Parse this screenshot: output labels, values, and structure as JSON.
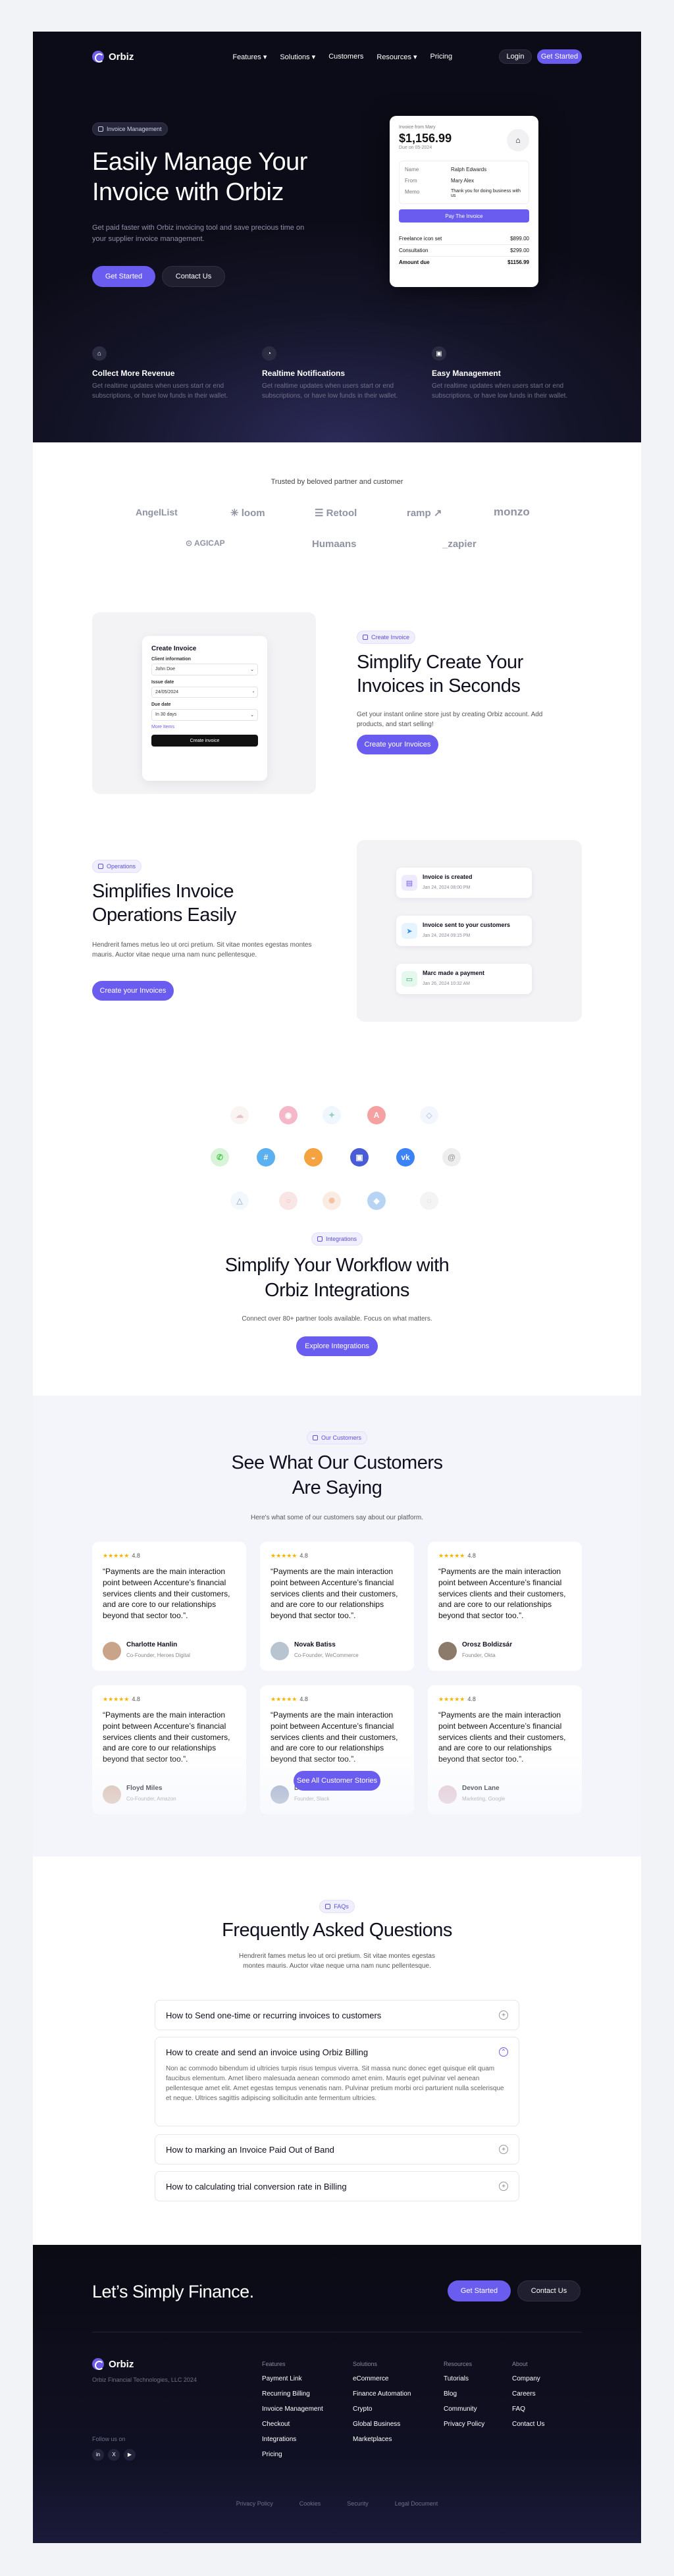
{
  "nav": {
    "brand": "Orbiz",
    "links": [
      "Features",
      "Solutions",
      "Customers",
      "Resources",
      "Pricing"
    ],
    "login": "Login",
    "get_started": "Get Started"
  },
  "hero": {
    "badge": "Invoice Management",
    "title_line1": "Easily Manage Your",
    "title_line2": "Invoice with Orbiz",
    "subtitle": "Get paid faster with Orbiz invoicing tool and save precious time on your supplier invoice management.",
    "cta_primary": "Get Started",
    "cta_secondary": "Contact Us",
    "invoice": {
      "label": "Invoice from Mary",
      "amount": "$1,156.99",
      "due": "Due on 05-2024",
      "rows": [
        {
          "k": "Name",
          "v": "Ralph Edwards"
        },
        {
          "k": "From",
          "v": "Mary Alex"
        },
        {
          "k": "Memo",
          "v": "Thank you for doing business with us"
        }
      ],
      "pay": "Pay The Invoice",
      "lines": [
        {
          "k": "Freelance icon set",
          "v": "$899.00"
        },
        {
          "k": "Consultation",
          "v": "$299.00"
        },
        {
          "k": "Amount due",
          "v": "$1156.99"
        }
      ]
    },
    "features": [
      {
        "icon": "bank-icon",
        "title": "Collect More Revenue",
        "text": "Get realtime updates when users start or end subscriptions, or have low funds in their wallet."
      },
      {
        "icon": "bell-icon",
        "title": "Realtime Notifications",
        "text": "Get realtime updates when users start or end subscriptions, or have low funds in their wallet."
      },
      {
        "icon": "wallet-icon",
        "title": "Easy Management",
        "text": "Get realtime updates when users start or end subscriptions, or have low funds in their wallet."
      }
    ]
  },
  "partners": {
    "heading": "Trusted by beloved partner and customer",
    "logos": [
      "AngelList",
      "loom",
      "Retool",
      "ramp",
      "monzo",
      "AGICAP",
      "Humaans",
      "zapier"
    ]
  },
  "create": {
    "badge": "Create Invoice",
    "title_line1": "Simplify Create Your",
    "title_line2": "Invoices in Seconds",
    "text": "Get your instant online store just by creating Orbiz account. Add products, and start selling!",
    "cta": "Create your Invoices",
    "form": {
      "title": "Create Invoice",
      "fields": [
        {
          "label": "Client information",
          "value": "John Doe"
        },
        {
          "label": "Issue date",
          "value": "24/05/2024"
        },
        {
          "label": "Due date",
          "value": "In 30 days"
        }
      ],
      "more": "More Items",
      "submit": "Create invoice"
    }
  },
  "ops": {
    "badge": "Operations",
    "title_line1": "Simplifies Invoice",
    "title_line2": "Operations Easily",
    "text": "Hendrerit fames metus leo ut orci pretium. Sit vitae montes egestas montes mauris. Auctor vitae neque urna nam nunc pellentesque.",
    "cta": "Create your Invoices",
    "timeline": [
      {
        "title": "Invoice is created",
        "date": "Jan 24, 2024 08:00 PM"
      },
      {
        "title": "Invoice sent to your customers",
        "date": "Jan 24, 2024 09:15 PM"
      },
      {
        "title": "Marc made a payment",
        "date": "Jan 26, 2024 10:32 AM"
      }
    ]
  },
  "integ": {
    "badge": "Integrations",
    "title_line1": "Simplify Your Workflow with",
    "title_line2": "Orbiz Integrations",
    "text": "Connect over 80+ partner tools available. Focus on what matters.",
    "cta": "Explore Integrations"
  },
  "testi": {
    "badge": "Our Customers",
    "title_line1": "See What Our Customers",
    "title_line2": "Are Saying",
    "subtitle": "Here's what some of our customers say about our platform.",
    "rating": "4.8",
    "stars": "★★★★★",
    "quote": "“Payments are the main interaction point between Accenture’s financial services clients and their customers, and are core to our relationships beyond that sector too.”.",
    "people": [
      {
        "name": "Charlotte Hanlin",
        "role": "Co-Founder, Heroes Digital"
      },
      {
        "name": "Novak Batiss",
        "role": "Co-Founder, WeCommerce"
      },
      {
        "name": "Orosz Boldizsár",
        "role": "Founder, Okta"
      },
      {
        "name": "Floyd Miles",
        "role": "Co-Founder, Amazon"
      },
      {
        "name": "Darrell Steward",
        "role": "Founder, Slack"
      },
      {
        "name": "Devon Lane",
        "role": "Marketing, Google"
      }
    ],
    "cta": "See All Customer Stories"
  },
  "faq": {
    "badge": "FAQs",
    "title": "Frequently Asked Questions",
    "subtitle": "Hendrerit fames metus leo ut orci pretium. Sit vitae montes egestas montes mauris. Auctor vitae neque urna nam nunc pellentesque.",
    "items": [
      {
        "q": "How to Send one-time or recurring invoices to customers"
      },
      {
        "q": "How to create and send an invoice using Orbiz Billing",
        "a": "Non ac commodo bibendum id ultricies turpis risus tempus viverra. Sit massa nunc donec eget quisque elit quam faucibus elementum. Amet libero malesuada aenean commodo amet enim. Mauris eget pulvinar vel aenean pellentesque amet elit. Amet egestas tempus venenatis nam. Pulvinar pretium morbi orci parturient nulla scelerisque et neque. Ultrices sagittis adipiscing sollicitudin ante fermentum ultricies."
      },
      {
        "q": "How to marking an Invoice Paid Out of Band"
      },
      {
        "q": "How to calculating trial conversion rate in Billing"
      }
    ]
  },
  "footer": {
    "cta_title": "Let’s Simply Finance.",
    "cta_primary": "Get Started",
    "cta_secondary": "Contact Us",
    "brand": "Orbiz",
    "legal": "Orbiz Financial Technologies, LLC 2024",
    "follow": "Follow us on",
    "cols": [
      {
        "h": "Features",
        "items": [
          "Payment Link",
          "Recurring Billing",
          "Invoice Management",
          "Checkout",
          "Integrations",
          "Pricing"
        ]
      },
      {
        "h": "Solutions",
        "items": [
          "eCommerce",
          "Finance Automation",
          "Crypto",
          "Global Business",
          "Marketplaces"
        ]
      },
      {
        "h": "Resources",
        "items": [
          "Tutorials",
          "Blog",
          "Community",
          "Privacy Policy"
        ]
      },
      {
        "h": "About",
        "items": [
          "Company",
          "Careers",
          "FAQ",
          "Contact Us"
        ]
      }
    ],
    "bottom": [
      "Privacy Policy",
      "Cookies",
      "Security",
      "Legal Document"
    ]
  },
  "colors": {
    "accent": "#6b5cf0",
    "dark": "#0c0c18"
  }
}
